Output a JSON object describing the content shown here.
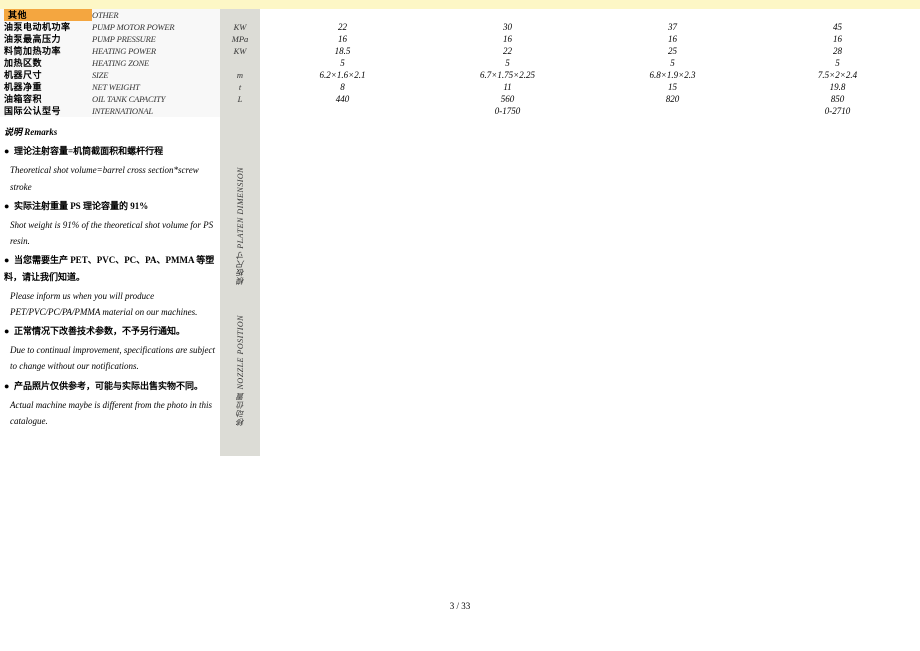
{
  "section": {
    "cn": "其他",
    "en": "OTHER"
  },
  "rows": [
    {
      "cn": "油泵电动机功率",
      "en": "PUMP MOTOR POWER",
      "unit": "KW",
      "vals": [
        "22",
        "30",
        "37",
        "45"
      ]
    },
    {
      "cn": "油泵最高压力",
      "en": "PUMP PRESSURE",
      "unit": "MPa",
      "vals": [
        "16",
        "16",
        "16",
        "16"
      ]
    },
    {
      "cn": "料筒加热功率",
      "en": "HEATING POWER",
      "unit": "KW",
      "vals": [
        "18.5",
        "22",
        "25",
        "28"
      ]
    },
    {
      "cn": "加热区数",
      "en": "HEATING ZONE",
      "unit": "",
      "vals": [
        "5",
        "5",
        "5",
        "5"
      ]
    },
    {
      "cn": "机器尺寸",
      "en": "SIZE",
      "unit": "m",
      "vals": [
        "6.2×1.6×2.1",
        "6.7×1.75×2.25",
        "6.8×1.9×2.3",
        "7.5×2×2.4"
      ]
    },
    {
      "cn": "机器净重",
      "en": "NET WEIGHT",
      "unit": "t",
      "vals": [
        "8",
        "11",
        "15",
        "19.8"
      ]
    },
    {
      "cn": "油箱容积",
      "en": "OIL TANK CAPACITY",
      "unit": "L",
      "vals": [
        "440",
        "560",
        "820",
        "850"
      ]
    },
    {
      "cn": "国际公认型号",
      "en": "INTERNATIONAL",
      "unit": "",
      "vals": [
        "",
        "0-1750",
        "",
        "0-2710"
      ]
    }
  ],
  "remarks": {
    "title": "说明 Remarks",
    "b1_cn": "理论注射容量=机筒截面积和螺杆行程",
    "b1_en": "Theoretical shot volume=barrel cross section*screw stroke",
    "b2_cn": "实际注射重量 PS 理论容量的 91%",
    "b2_en": "Shot weight is 91% of the theoretical shot volume for PS resin.",
    "b3_cn": "当您需要生产 PET、PVC、PC、PA、PMMA 等塑料，请让我们知道。",
    "b3_en": "Please inform us when you will produce PET/PVC/PC/PA/PMMA material on our machines.",
    "b4_cn": "正常情况下改善技术参数，不予另行通知。",
    "b4_en": "Due to continual improvement, specifications are subject to change without our notifications.",
    "b5_cn": "产品照片仅供参考，可能与实际出售实物不同。",
    "b5_en": "Actual machine maybe is different from the photo in this catalogue."
  },
  "side": {
    "v1": "模板尺寸 PLATEN DIMENSION",
    "v2": "移动位置 NOZZLE POSITION"
  },
  "footer": {
    "page": "3 / 33"
  }
}
